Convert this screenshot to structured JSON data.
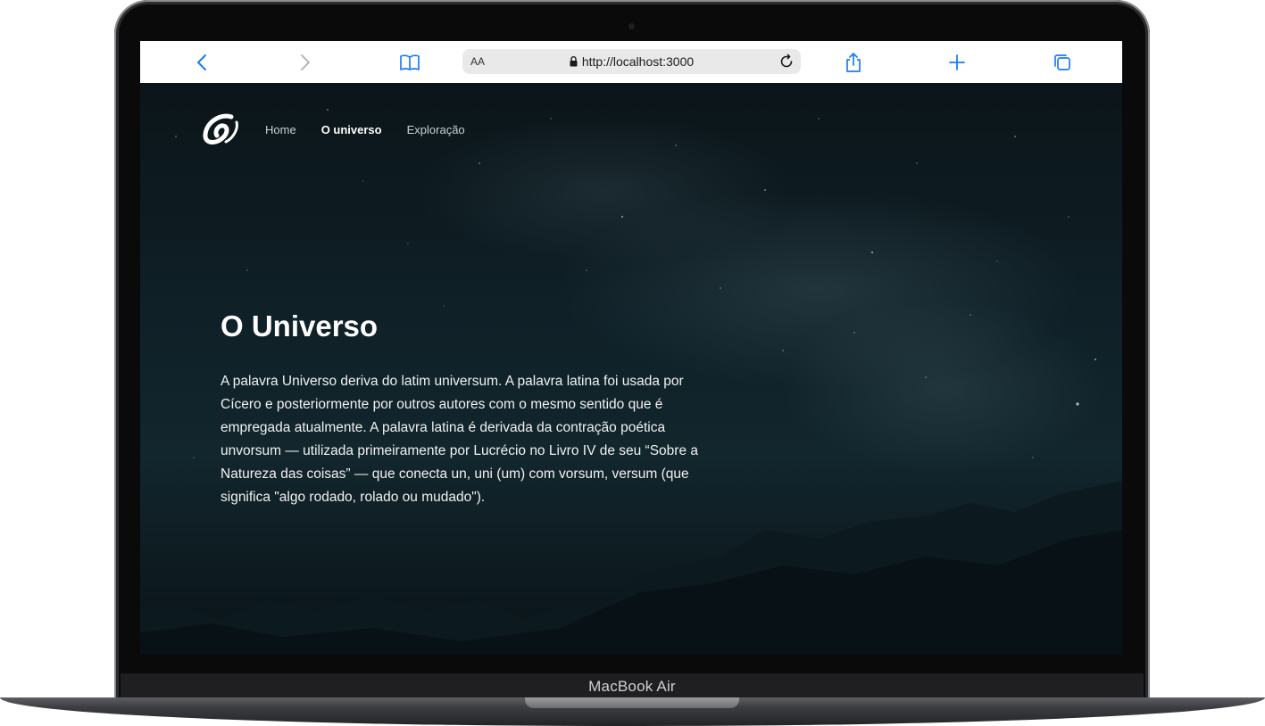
{
  "browser": {
    "address_aa": "AA",
    "url": "http://localhost:3000"
  },
  "site": {
    "nav": [
      {
        "label": "Home",
        "active": false
      },
      {
        "label": "O universo",
        "active": true
      },
      {
        "label": "Exploração",
        "active": false
      }
    ],
    "hero": {
      "title": "O Universo",
      "text": "A palavra Universo deriva do latim universum. A palavra latina foi usada por Cícero e posteriormente por outros autores com o mesmo sentido que é empregada atualmente. A palavra latina é derivada da contração poética unvorsum — utilizada primeiramente por Lucrécio no Livro IV de seu “Sobre a Natureza das coisas” — que conecta un, uni (um) com vorsum, versum (que significa \"algo rodado, rolado ou mudado\")."
    }
  },
  "device": {
    "label": "MacBook Air"
  },
  "icons": [
    "back-icon",
    "forward-icon",
    "bookmarks-icon",
    "lock-icon",
    "reload-icon",
    "share-icon",
    "new-tab-icon",
    "tabs-icon",
    "site-logo-icon"
  ],
  "colors": {
    "accent": "#1a7cf5",
    "page_bg": "#0f2027"
  }
}
